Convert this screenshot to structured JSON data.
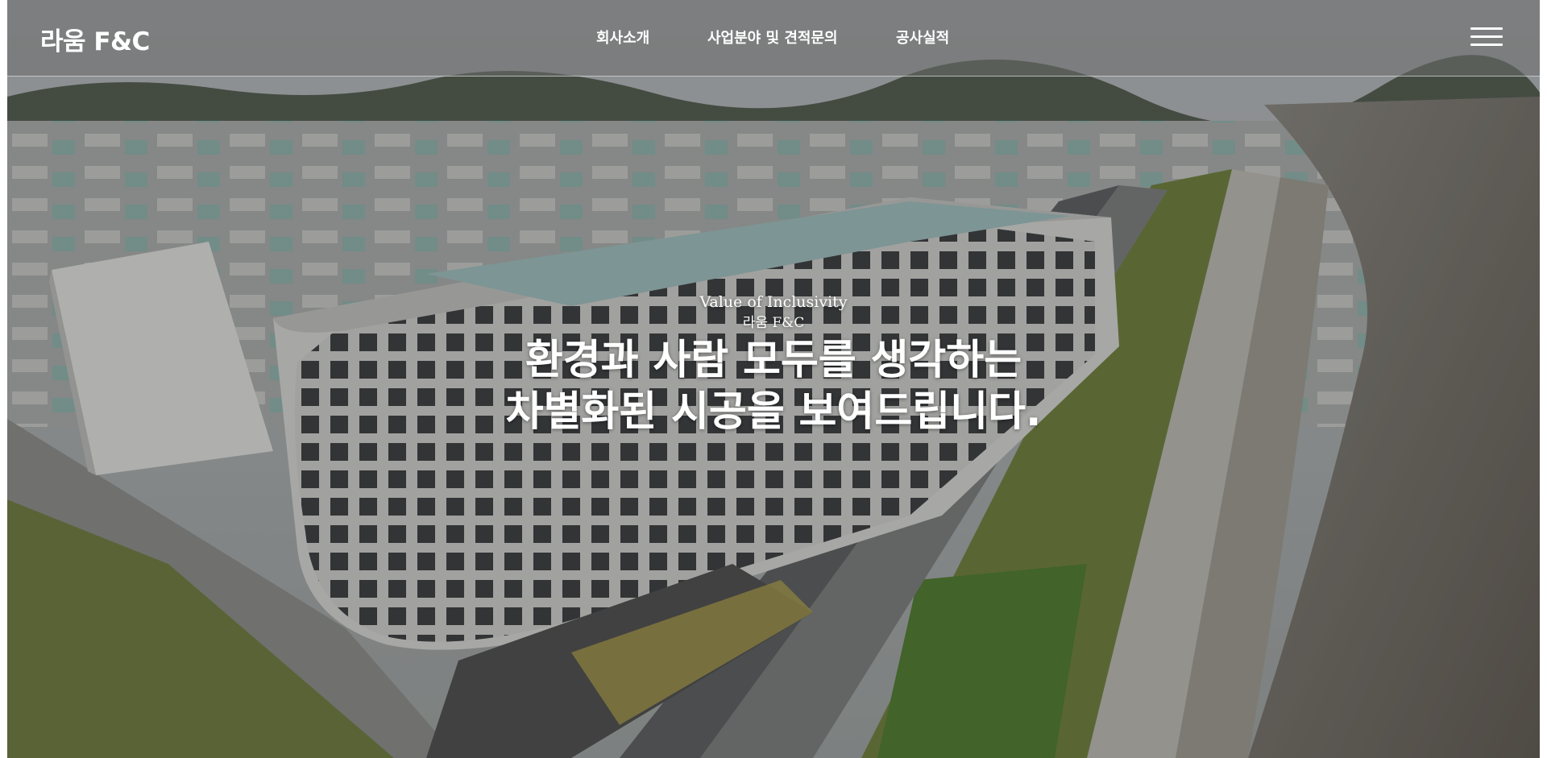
{
  "header": {
    "logo_text": "라움 F&C",
    "nav": [
      {
        "label": "회사소개"
      },
      {
        "label": "사업분야 및 견적문의"
      },
      {
        "label": "공사실적"
      }
    ],
    "menu_icon": "hamburger-menu-icon"
  },
  "hero": {
    "eyebrow": "Value of Inclusivity",
    "brand": "라움 F&C",
    "headline_line1": "환경과 사람 모두를 생각하는",
    "headline_line2": "차별화된 시공을 보여드립니다."
  },
  "colors": {
    "header_overlay": "#6e6e6e",
    "text": "#ffffff",
    "building": "#d9d9d6",
    "river": "#6f6a62",
    "greenery": "#6d7f3a"
  }
}
